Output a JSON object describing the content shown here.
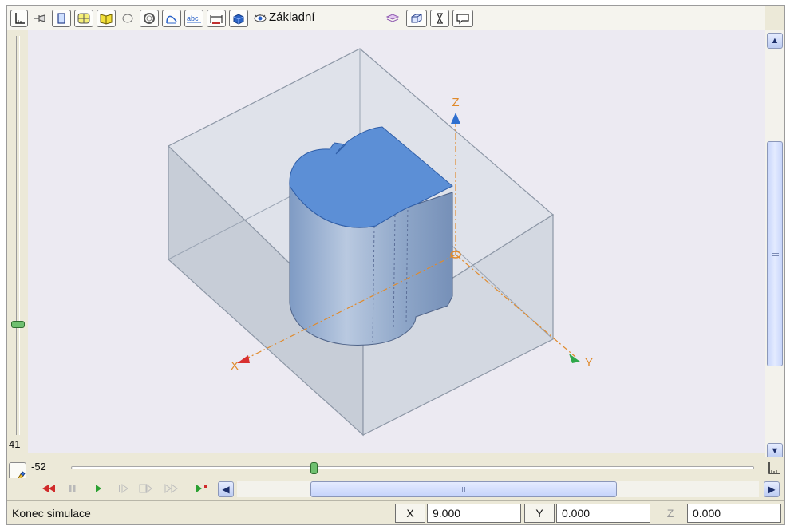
{
  "toolbar": {
    "view_mode_label": "Základní",
    "icons": [
      "axis-icon",
      "pin-icon",
      "panel-icon",
      "grid-icon",
      "book-icon",
      "circle-outline-icon",
      "ring-icon",
      "curve-icon",
      "text-abc-icon",
      "dimension-icon",
      "solid-icon",
      "eye-icon",
      "layers-icon",
      "box-icon",
      "hourglass-icon",
      "comment-icon"
    ]
  },
  "left_slider": {
    "value": "41"
  },
  "horizontal_slider": {
    "value": "-52"
  },
  "playback": {
    "buttons": [
      "rewind",
      "pause",
      "play",
      "step-forward",
      "end-segment",
      "fast-forward",
      "play-to-stop"
    ]
  },
  "axes": {
    "x": "X",
    "y": "Y",
    "z": "Z"
  },
  "status": {
    "message": "Konec simulace",
    "x_label": "X",
    "x_value": "9.000",
    "y_label": "Y",
    "y_value": "0.000",
    "z_label": "Z",
    "z_value": "0.000"
  },
  "colors": {
    "part_top": "#5c8fd6",
    "part_side": "#90a8c8",
    "stock_box": "#b6c0cc",
    "axis": "#e08a2c",
    "slider_thumb": "#6fc06f"
  }
}
